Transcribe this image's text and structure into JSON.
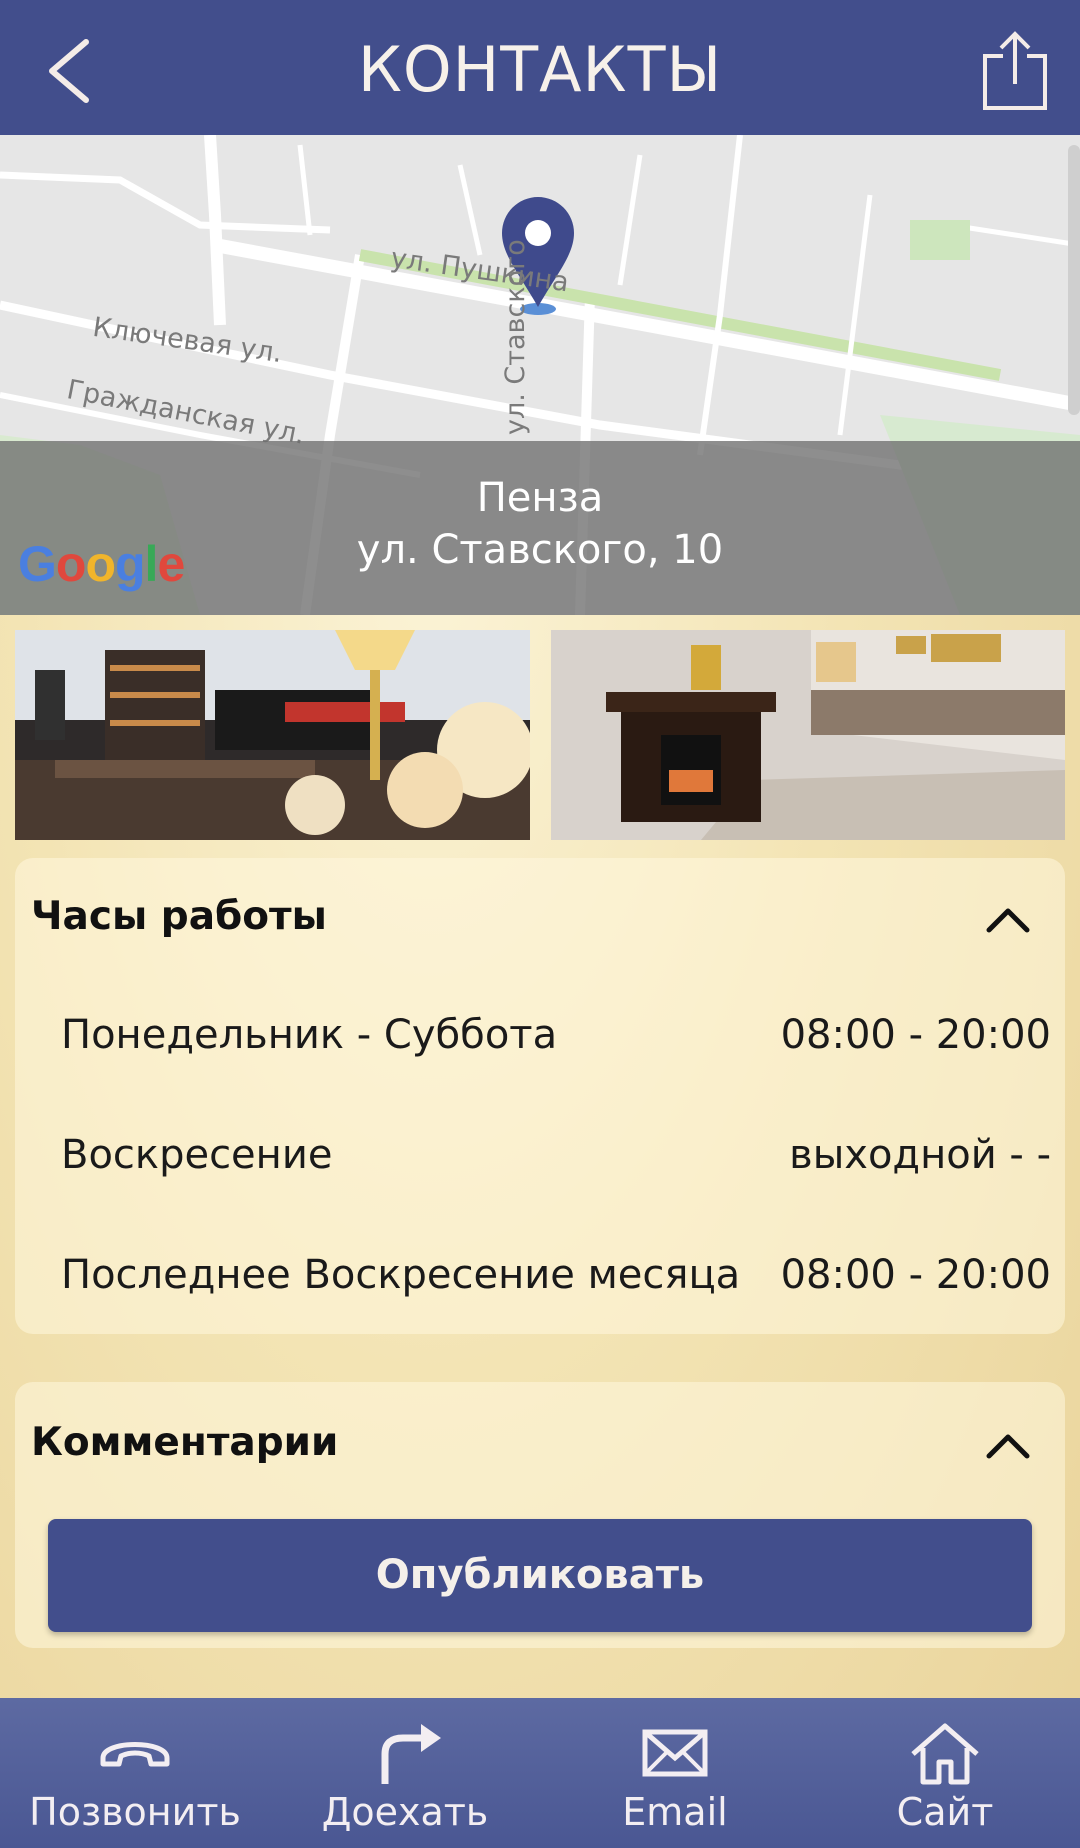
{
  "header": {
    "title": "КОНТАКТЫ",
    "back_icon": "back-arrow-icon",
    "share_icon": "share-icon"
  },
  "map": {
    "streets": [
      "ул. Пушкина",
      "Ключевая ул.",
      "Гражданская ул.",
      "ул. Ставского"
    ],
    "city": "Пенза",
    "address": "ул. Ставского, 10",
    "logo": "Google",
    "marker_icon": "map-pin-icon"
  },
  "photos": [
    "interior-bar-photo",
    "interior-fireplace-photo"
  ],
  "hours": {
    "title": "Часы работы",
    "rows": [
      {
        "day": "Понедельник - Суббота",
        "time": "08:00 - 20:00"
      },
      {
        "day": "Воскресение",
        "time": "выходной - -"
      },
      {
        "day": "Последнее Воскресение месяца",
        "time": "08:00 - 20:00"
      }
    ]
  },
  "comments": {
    "title": "Комментарии",
    "publish_label": "Опубликовать"
  },
  "bottom_nav": [
    {
      "label": "Позвонить",
      "icon": "phone-icon"
    },
    {
      "label": "Доехать",
      "icon": "directions-icon"
    },
    {
      "label": "Email",
      "icon": "envelope-icon"
    },
    {
      "label": "Сайт",
      "icon": "home-icon"
    }
  ],
  "colors": {
    "primary": "#424e8c",
    "nav": "#52609a",
    "background": "#f3e4b4",
    "map_overlay": "#6e6e6e"
  }
}
